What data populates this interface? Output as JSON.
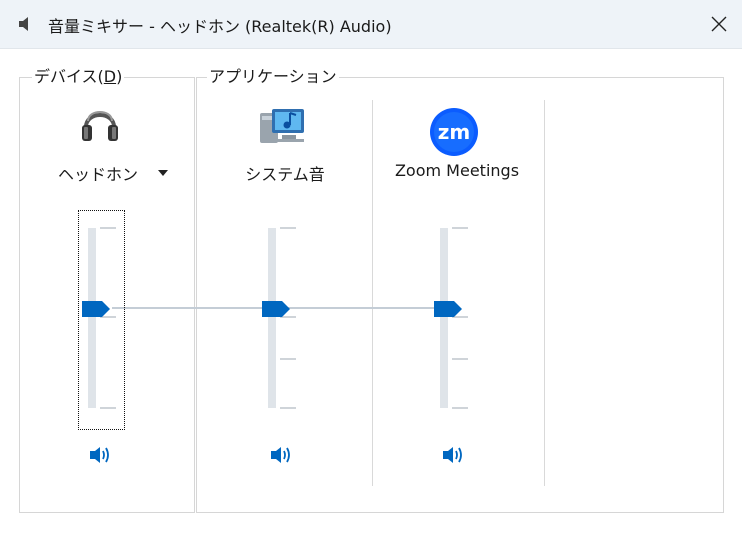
{
  "window": {
    "title": "音量ミキサー - ヘッドホン (Realtek(R) Audio)"
  },
  "device_group": {
    "label_prefix": "デバイス(",
    "label_access": "D",
    "label_suffix": ")",
    "device": {
      "name": "ヘッドホン",
      "icon": "headphones-icon",
      "volume_level": 0.5,
      "muted": false
    }
  },
  "apps_group": {
    "label": "アプリケーション",
    "apps": [
      {
        "name": "システム音",
        "icon": "system-sounds-icon",
        "volume_level": 0.5,
        "muted": false
      },
      {
        "name": "Zoom Meetings",
        "icon": "zoom-icon",
        "volume_level": 0.5,
        "muted": false
      }
    ]
  },
  "colors": {
    "accent": "#0067c0",
    "titlebar": "#eef3f8",
    "slider_track": "#dfe4e9"
  }
}
